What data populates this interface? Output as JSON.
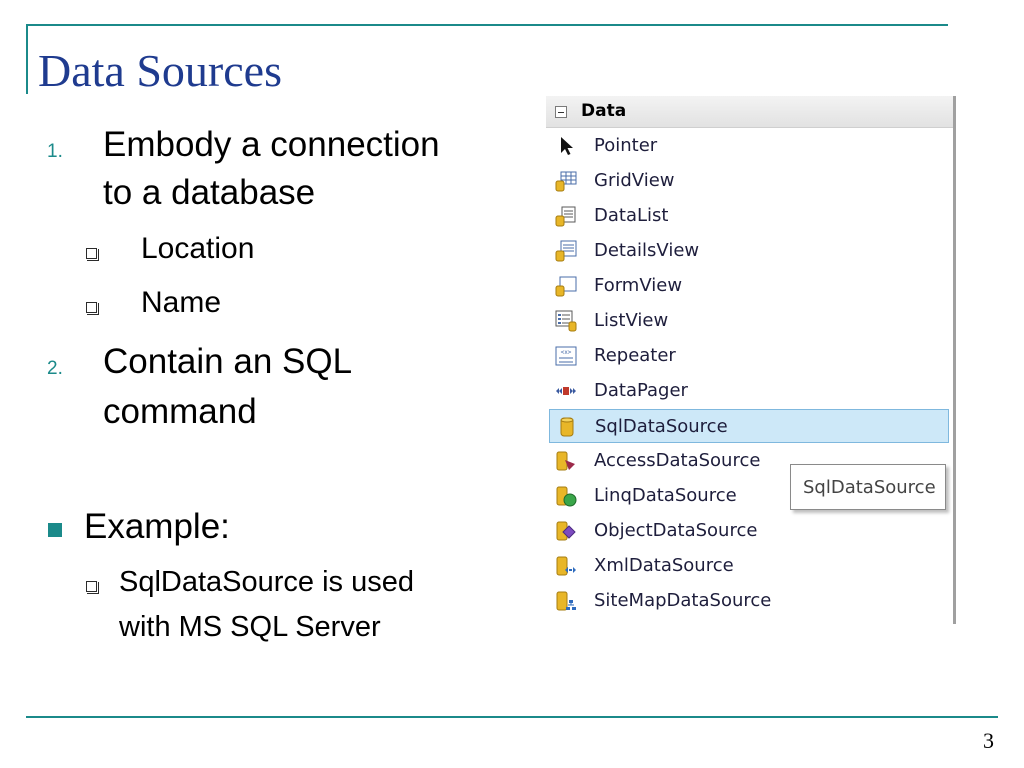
{
  "slide": {
    "title": "Data Sources",
    "page_number": "3"
  },
  "content": {
    "item1_num": "1.",
    "item1_line1": "Embody a connection",
    "item1_line2": "to a database",
    "sub1": "Location",
    "sub2": "Name",
    "item2_num": "2.",
    "item2_line1": "Contain an SQL",
    "item2_line2": "command",
    "example_label": "Example:",
    "example_line1": "SqlDataSource is used",
    "example_line2": "with MS SQL Server"
  },
  "toolbox": {
    "header": "Data",
    "items": [
      {
        "label": "Pointer",
        "icon": "pointer-icon"
      },
      {
        "label": "GridView",
        "icon": "gridview-icon"
      },
      {
        "label": "DataList",
        "icon": "datalist-icon"
      },
      {
        "label": "DetailsView",
        "icon": "detailsview-icon"
      },
      {
        "label": "FormView",
        "icon": "formview-icon"
      },
      {
        "label": "ListView",
        "icon": "listview-icon"
      },
      {
        "label": "Repeater",
        "icon": "repeater-icon"
      },
      {
        "label": "DataPager",
        "icon": "datapager-icon"
      },
      {
        "label": "SqlDataSource",
        "icon": "sqldatasource-icon",
        "selected": true
      },
      {
        "label": "AccessDataSource",
        "icon": "accessdatasource-icon"
      },
      {
        "label": "LinqDataSource",
        "icon": "linqdatasource-icon"
      },
      {
        "label": "ObjectDataSource",
        "icon": "objectdatasource-icon"
      },
      {
        "label": "XmlDataSource",
        "icon": "xmldatasource-icon"
      },
      {
        "label": "SiteMapDataSource",
        "icon": "sitemapdatasource-icon"
      }
    ],
    "tooltip": "SqlDataSource"
  },
  "colors": {
    "accent": "#1b8a8a",
    "title": "#1f3b8f",
    "selection": "#cde8f8"
  }
}
